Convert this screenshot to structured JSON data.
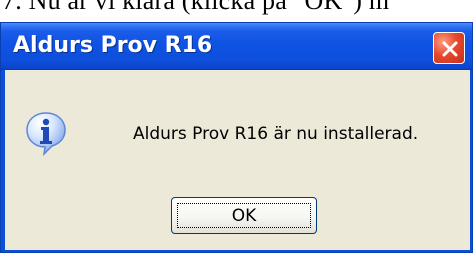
{
  "document": {
    "cropped_text": "7. Nu är vi klara (klicka på \"OK\") m"
  },
  "dialog": {
    "title": "Aldurs Prov R16",
    "message": "Aldurs Prov R16 är nu installerad.",
    "ok_label": "OK",
    "icon": "info-icon",
    "close_icon": "close-icon"
  },
  "colors": {
    "titlebar_blue": "#0f53e4",
    "dialog_bg": "#ece9d8",
    "close_red": "#e64a2e"
  }
}
